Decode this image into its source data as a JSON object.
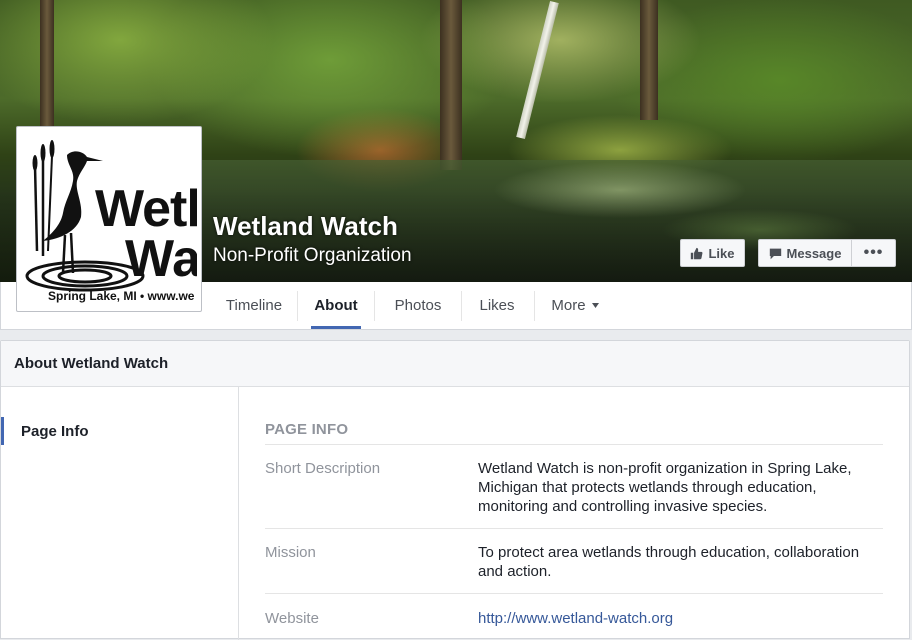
{
  "page": {
    "name": "Wetland Watch",
    "category": "Non-Profit Organization"
  },
  "logo": {
    "line1": "Wetl",
    "line2": "Wa",
    "caption": "Spring Lake, MI • www.we"
  },
  "actions": {
    "like": "Like",
    "message": "Message",
    "more": "•••"
  },
  "tabs": [
    {
      "label": "Timeline"
    },
    {
      "label": "About"
    },
    {
      "label": "Photos"
    },
    {
      "label": "Likes"
    },
    {
      "label": "More"
    }
  ],
  "about": {
    "header": "About Wetland Watch",
    "sidebar": [
      "Page Info"
    ],
    "section_title": "PAGE INFO",
    "rows": [
      {
        "label": "Short Description",
        "value": "Wetland Watch is non-profit organization in Spring Lake, Michigan that protects wetlands through education, monitoring and controlling invasive species."
      },
      {
        "label": "Mission",
        "value": "To protect area wetlands through education, collaboration and action."
      },
      {
        "label": "Website",
        "value": "http://www.wetland-watch.org"
      }
    ]
  },
  "colors": {
    "accent": "#4267b2",
    "link": "#365899",
    "muted": "#90949c"
  }
}
